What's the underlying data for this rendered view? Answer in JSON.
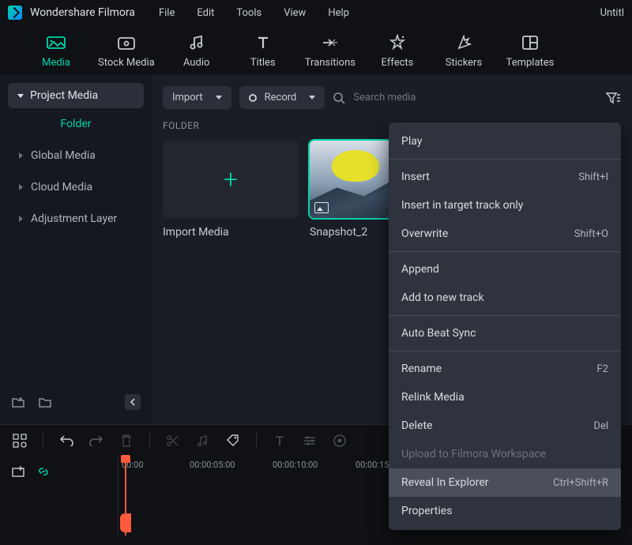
{
  "app": {
    "name": "Wondershare Filmora",
    "doc": "Untitl"
  },
  "menubar": [
    "File",
    "Edit",
    "Tools",
    "View",
    "Help"
  ],
  "tabs": [
    {
      "label": "Media",
      "icon": "media-icon",
      "active": true
    },
    {
      "label": "Stock Media",
      "icon": "stock-icon"
    },
    {
      "label": "Audio",
      "icon": "audio-icon"
    },
    {
      "label": "Titles",
      "icon": "titles-icon"
    },
    {
      "label": "Transitions",
      "icon": "transitions-icon"
    },
    {
      "label": "Effects",
      "icon": "effects-icon"
    },
    {
      "label": "Stickers",
      "icon": "stickers-icon"
    },
    {
      "label": "Templates",
      "icon": "templates-icon"
    }
  ],
  "sidebar": {
    "pill": "Project Media",
    "folder_link": "Folder",
    "items": [
      "Global Media",
      "Cloud Media",
      "Adjustment Layer"
    ]
  },
  "toolbar": {
    "import": "Import",
    "record": "Record",
    "search_placeholder": "Search media"
  },
  "section": {
    "label": "FOLDER"
  },
  "cards": {
    "import": "Import Media",
    "snapshot": "Snapshot_2"
  },
  "ctx": {
    "play": "Play",
    "insert": "Insert",
    "insert_sc": "Shift+I",
    "insert_target": "Insert in target track only",
    "overwrite": "Overwrite",
    "overwrite_sc": "Shift+O",
    "append": "Append",
    "add_track": "Add to new track",
    "autobeat": "Auto Beat Sync",
    "rename": "Rename",
    "rename_sc": "F2",
    "relink": "Relink Media",
    "delete": "Delete",
    "delete_sc": "Del",
    "upload": "Upload to Filmora Workspace",
    "reveal": "Reveal In Explorer",
    "reveal_sc": "Ctrl+Shift+R",
    "properties": "Properties"
  },
  "timeline": {
    "tc0": "00:00",
    "tc1": "00:00:05:00",
    "tc2": "00:00:10:00",
    "tc3": "00:00:15:"
  }
}
